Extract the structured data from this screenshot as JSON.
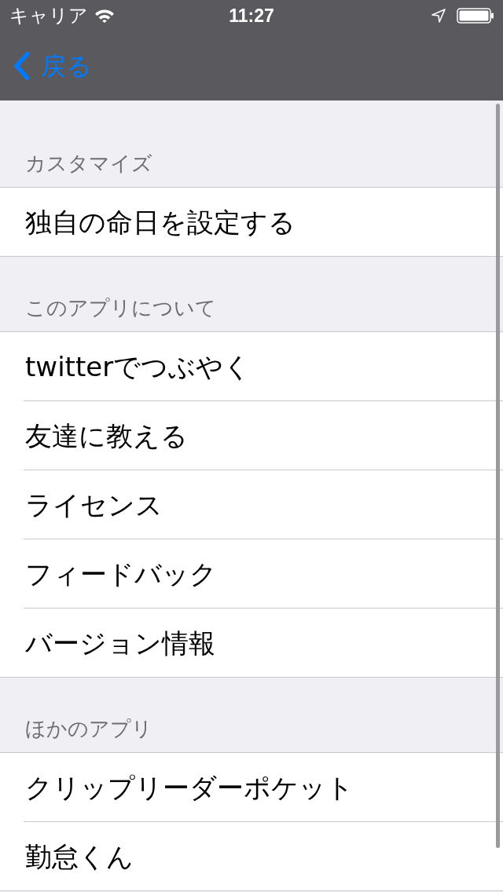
{
  "status_bar": {
    "carrier": "キャリア",
    "time": "11:27"
  },
  "nav_bar": {
    "back_label": "戻る"
  },
  "sections": [
    {
      "header": "カスタマイズ",
      "items": [
        "独自の命日を設定する"
      ]
    },
    {
      "header": "このアプリについて",
      "items": [
        "twitterでつぶやく",
        "友達に教える",
        "ライセンス",
        "フィードバック",
        "バージョン情報"
      ]
    },
    {
      "header": "ほかのアプリ",
      "items": [
        "クリップリーダーポケット",
        "勤怠くん"
      ]
    }
  ]
}
